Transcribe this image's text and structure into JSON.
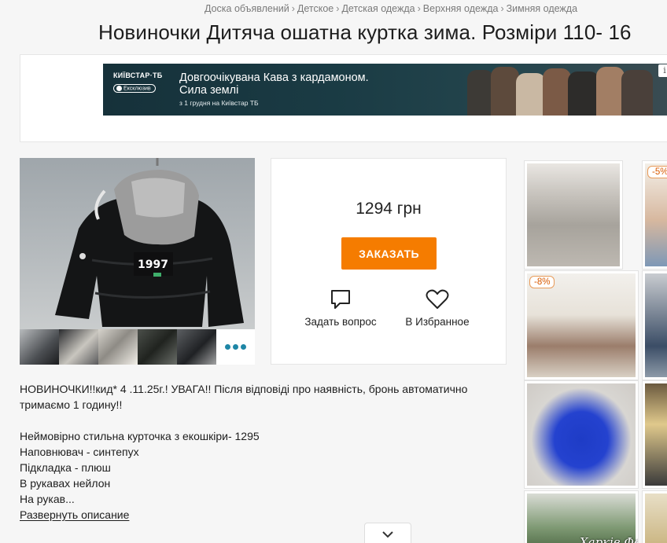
{
  "breadcrumb": {
    "items": [
      "Доска объявлений",
      "Детское",
      "Детская одежда",
      "Верхняя одежда",
      "Зимняя одежда"
    ],
    "separator": "›"
  },
  "page_title": "Новиночки Дитяча ошатна куртка зима. Розміри 110- 16",
  "ad_banner": {
    "brand": "КИЇВСТАР·ТБ",
    "brand_badge": "Ексклюзив",
    "headline_line1": "Довгоочікувана Кава з кардамоном.",
    "headline_line2": "Сила землі",
    "subline": "з 1 грудня на Київстар ТБ",
    "info_icon": "info-icon",
    "colors": {
      "background": "#16313a",
      "text": "#ffffff"
    }
  },
  "product": {
    "photo_print": "1997",
    "thumbnails_more_icon": "more-dots-icon"
  },
  "buy_box": {
    "price": "1294 грн",
    "order_button": "ЗАКАЗАТЬ",
    "ask_label": "Задать вопрос",
    "ask_icon": "chat-bubble-icon",
    "favorite_label": "В Избранное",
    "favorite_icon": "heart-icon",
    "colors": {
      "order_button": "#f57c00"
    }
  },
  "description": {
    "paragraph1": "НОВИНОЧКИ!!кид* 4 .11.25г.! УВАГА!! Після відповіді про наявність, бронь автоматично тримаємо 1 годину!!",
    "lines": [
      "Неймовірно стильна курточка з екошкіри- 1295",
      "Наповнювач - синтепух",
      "Підкладка - плюш",
      "В рукавах нейлон",
      "На рукав..."
    ],
    "expand_link": "Развернуть описание"
  },
  "scroll_down_icon": "chevron-down-icon",
  "side_ads": [
    {
      "badge": ""
    },
    {
      "badge": "-5%"
    },
    {
      "badge": "-8%"
    },
    {
      "badge": ""
    },
    {
      "badge": ""
    },
    {
      "badge": ""
    },
    {
      "badge": ""
    },
    {
      "badge": "",
      "watermark": "Харків Форум"
    }
  ]
}
